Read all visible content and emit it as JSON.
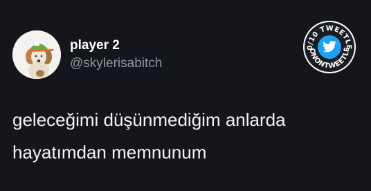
{
  "tweet": {
    "display_name": "player 2",
    "username": "@skylerisabitch",
    "text_lines": [
      "geleceğimi düşünmediğim anlarda",
      "hayatımdan memnunum"
    ]
  },
  "badge": {
    "top_text": "10/10 TWEETLER",
    "bottom_text": "@ONONTWEETLER",
    "icon": "twitter-bird-icon",
    "color_outer": "#ffffff",
    "color_inner": "#1da1f2"
  },
  "avatar": {
    "icon": "dog-with-hat-avatar"
  },
  "colors": {
    "background": "#15161b",
    "primary_text": "#ffffff",
    "secondary_text": "#8b98a5",
    "accent": "#1da1f2"
  }
}
